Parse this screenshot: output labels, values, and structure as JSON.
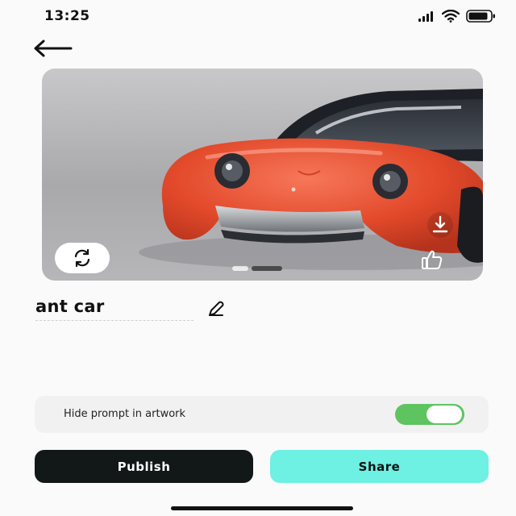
{
  "status_bar": {
    "time": "13:25",
    "icons": [
      "cellular-signal-icon",
      "wifi-icon",
      "battery-icon"
    ]
  },
  "nav": {
    "back_icon": "arrow-left-icon"
  },
  "artwork": {
    "pager_count": 2,
    "pager_active": 1,
    "actions": [
      "refresh-icon",
      "download-icon",
      "thumbs-up-icon"
    ]
  },
  "artwork_title": {
    "text": "ant car",
    "edit_icon": "pencil-icon"
  },
  "settings": {
    "hide_prompt_label": "Hide prompt in artwork",
    "hide_prompt_enabled": true
  },
  "actions": {
    "publish_label": "Publish",
    "share_label": "Share"
  },
  "colors": {
    "publish_bg": "#121718",
    "share_bg": "#6ef0e3",
    "toggle_on": "#5dc460",
    "car_body": "#e8502f"
  }
}
